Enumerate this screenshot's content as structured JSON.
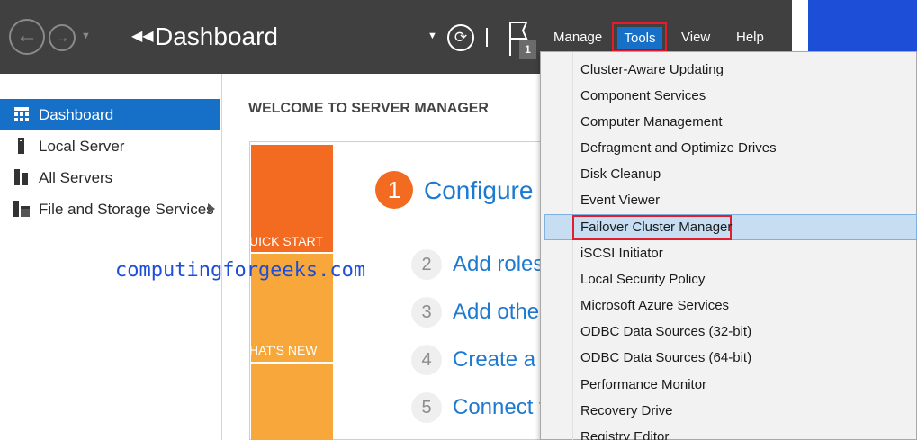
{
  "header": {
    "title": "Dashboard",
    "notification_count": "1",
    "menu": {
      "manage": "Manage",
      "tools": "Tools",
      "view": "View",
      "help": "Help"
    },
    "icons": {
      "back": "back-arrow-icon",
      "forward": "forward-arrow-icon",
      "refresh": "refresh-icon",
      "flag": "flag-icon"
    }
  },
  "sidebar": {
    "items": [
      {
        "label": "Dashboard",
        "icon": "dashboard-grid-icon",
        "active": true
      },
      {
        "label": "Local Server",
        "icon": "server-icon"
      },
      {
        "label": "All Servers",
        "icon": "servers-icon"
      },
      {
        "label": "File and Storage Services",
        "icon": "storage-icon",
        "has_submenu": true
      }
    ]
  },
  "main": {
    "welcome": "WELCOME TO SERVER MANAGER",
    "tiles": [
      "UICK START",
      "HAT'S NEW"
    ],
    "steps": [
      {
        "num": "1",
        "text": "Configure t"
      },
      {
        "num": "2",
        "text": "Add roles a"
      },
      {
        "num": "3",
        "text": "Add other"
      },
      {
        "num": "4",
        "text": "Create a se"
      },
      {
        "num": "5",
        "text": "Connect th"
      }
    ]
  },
  "watermark": "computingforgeeks.com",
  "tools_menu": {
    "items": [
      "Cluster-Aware Updating",
      "Component Services",
      "Computer Management",
      "Defragment and Optimize Drives",
      "Disk Cleanup",
      "Event Viewer",
      "Failover Cluster Manager",
      "iSCSI Initiator",
      "Local Security Policy",
      "Microsoft Azure Services",
      "ODBC Data Sources (32-bit)",
      "ODBC Data Sources (64-bit)",
      "Performance Monitor",
      "Recovery Drive",
      "Registry Editor"
    ],
    "highlighted": "Failover Cluster Manager"
  },
  "colors": {
    "topbar": "#404040",
    "accent": "#1670c7",
    "orange": "#f26b21",
    "light_orange": "#f8a83a",
    "highlight_border": "#e11d2e",
    "link": "#1e7ad0"
  }
}
